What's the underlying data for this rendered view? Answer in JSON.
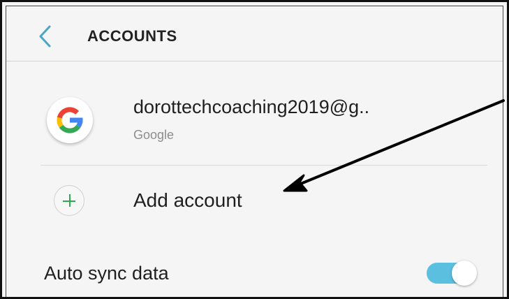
{
  "header": {
    "title": "ACCOUNTS",
    "back_icon": "chevron-left-icon"
  },
  "account": {
    "email": "dorottechcoaching2019@g..",
    "provider": "Google",
    "icon": "google-icon"
  },
  "add_account": {
    "label": "Add account",
    "icon": "plus-icon"
  },
  "auto_sync": {
    "label": "Auto sync data",
    "enabled": true
  },
  "colors": {
    "accent": "#4aa6c9",
    "toggle_on": "#5bbfe0",
    "plus": "#2fa84f",
    "annotation_arrow": "#000000"
  }
}
